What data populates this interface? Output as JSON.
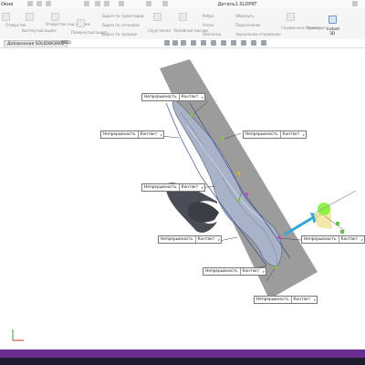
{
  "window": {
    "menu_label": "Окно",
    "title": "Деталь1.SLDPRT"
  },
  "ribbon": {
    "commands": [
      "Отверстие",
      "Вытянутый вырез",
      "Отверстие под крепеж",
      "Повернутый вырез",
      "Вырез по траектории",
      "Вырез по сечениям",
      "Вырез по границе",
      "Скругление",
      "Линейный массив",
      "Ребро",
      "Уклон",
      "Оболочка",
      "Обернуть",
      "Пересечение",
      "Зеркальное отражение",
      "Справочная геометрия",
      "Кривые"
    ],
    "instant3d_label": "Instant 3D"
  },
  "tabs": [
    "Добавления SOLIDWORKS",
    "MBD"
  ],
  "labels": {
    "continuity": "Непрерывность",
    "contact": "Контакт",
    "dropdown": "∨"
  },
  "colors": {
    "surface": "#a9b3c7",
    "plane": "#8a8a8a",
    "dragger": "#33a6d6",
    "dragger_hot": "#7cf230",
    "status_bar": "#6c2d91"
  },
  "icons": [
    "save-icon",
    "undo-icon",
    "print-icon",
    "zoom-icon",
    "view-orientation-icon",
    "dragger-icon"
  ]
}
